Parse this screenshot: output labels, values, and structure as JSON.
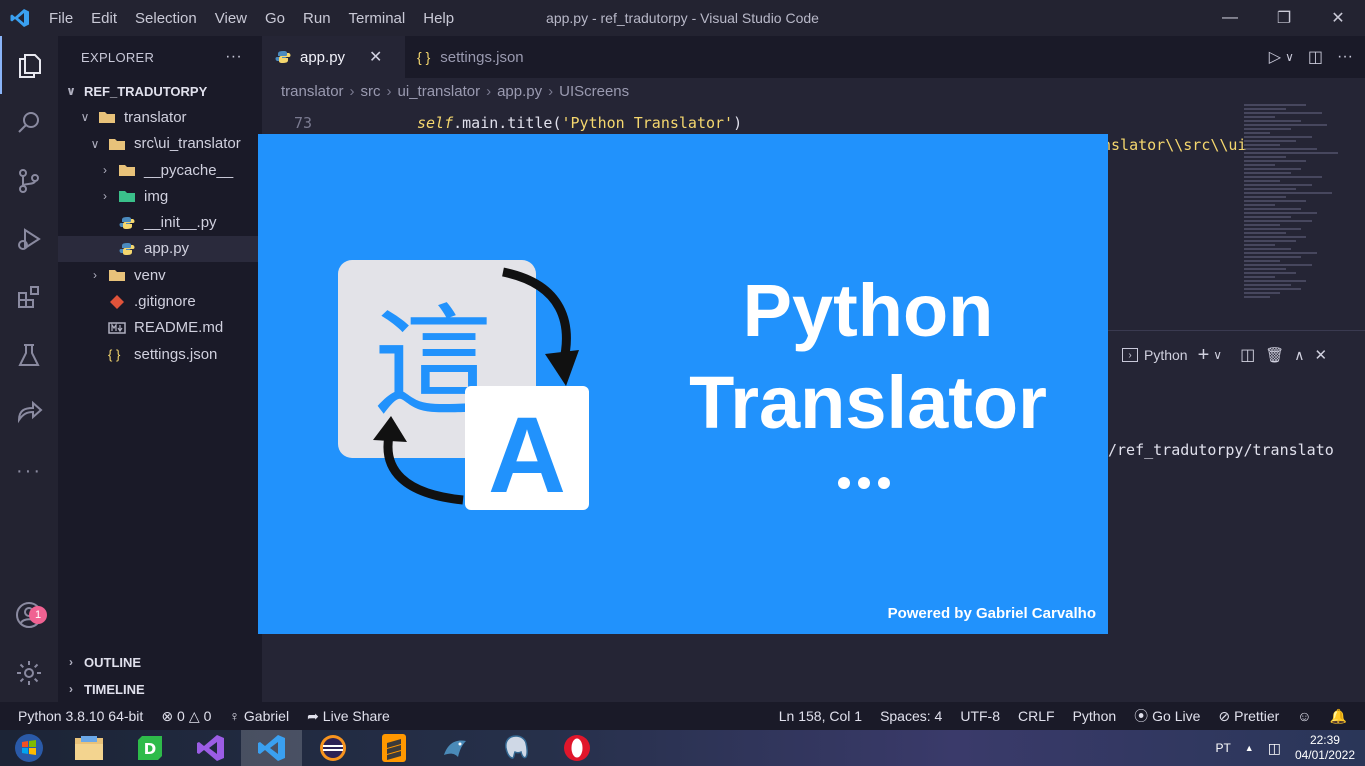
{
  "titlebar": {
    "menu": [
      "File",
      "Edit",
      "Selection",
      "View",
      "Go",
      "Run",
      "Terminal",
      "Help"
    ],
    "title": "app.py - ref_tradutorpy - Visual Studio Code"
  },
  "activity": {
    "account_badge": "1"
  },
  "sidebar": {
    "header": "EXPLORER",
    "more": "···",
    "root": "REF_TRADUTORPY",
    "items": [
      {
        "label": "translator"
      },
      {
        "label": "src\\ui_translator"
      },
      {
        "label": "__pycache__"
      },
      {
        "label": "img"
      },
      {
        "label": "__init__.py"
      },
      {
        "label": "app.py"
      },
      {
        "label": "venv"
      },
      {
        "label": ".gitignore"
      },
      {
        "label": "README.md"
      },
      {
        "label": "settings.json"
      }
    ],
    "outline": "OUTLINE",
    "timeline": "TIMELINE"
  },
  "tabs": [
    {
      "label": "app.py"
    },
    {
      "label": "settings.json",
      "icon_text": "{ }"
    }
  ],
  "breadcrumb": [
    "translator",
    "src",
    "ui_translator",
    "app.py",
    "UIScreens"
  ],
  "editor": {
    "line_73": "73",
    "code_73_kw": "self",
    "code_73_rest": ".main.title(",
    "code_73_str": "'Python Translator'",
    "code_73_end": ")",
    "code_74_tail": "nslator\\\\src\\\\ui"
  },
  "panel": {
    "shell": "Python",
    "terminal_line": "/ref_tradutorpy/translato"
  },
  "splash": {
    "title_line1": "Python",
    "title_line2": "Translator",
    "powered": "Powered by Gabriel Carvalho",
    "glyph_char": "這",
    "glyph_letter": "A"
  },
  "statusbar": {
    "interpreter": "Python 3.8.10 64-bit",
    "errors": "0",
    "warnings": "0",
    "user": "Gabriel",
    "live_share": "Live Share",
    "position": "Ln 158, Col 1",
    "spaces": "Spaces: 4",
    "encoding": "UTF-8",
    "eol": "CRLF",
    "language": "Python",
    "go_live": "Go Live",
    "prettier": "Prettier"
  },
  "taskbar": {
    "lang": "PT",
    "time": "22:39",
    "date": "04/01/2022"
  },
  "colors": {
    "splash_bg": "#2192fc",
    "accent": "#8ab4f8"
  }
}
